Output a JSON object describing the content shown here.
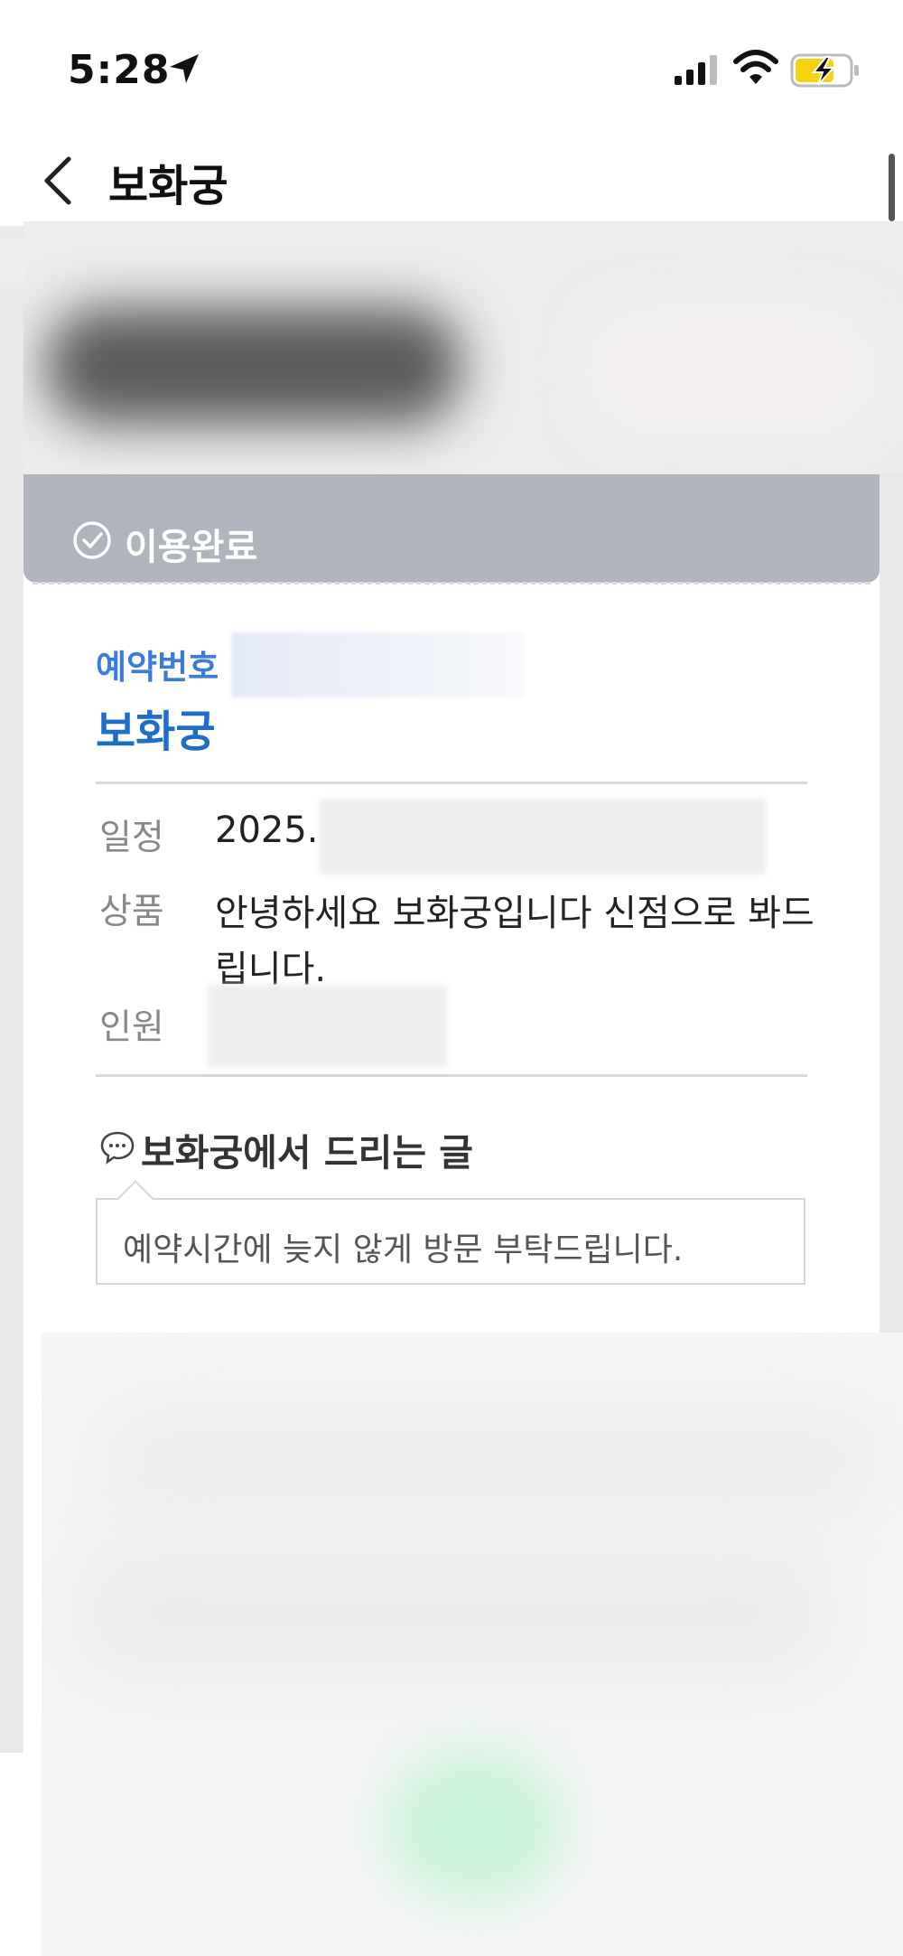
{
  "status_bar": {
    "time": "5:28"
  },
  "header": {
    "title": "보화궁"
  },
  "reservation": {
    "status": "이용완료",
    "number_label": "예약번호",
    "place_name": "보화궁",
    "rows": {
      "schedule_label": "일정",
      "schedule_value": "2025.",
      "product_label": "상품",
      "product_value_line1": "안녕하세요 보화궁입니다 신점으로 봐드",
      "product_value_line2": "립니다.",
      "people_label": "인원"
    },
    "message": {
      "title": "보화궁에서 드리는 글",
      "text": "예약시간에 늦지 않게 방문 부탁드립니다."
    }
  },
  "colors": {
    "accent_blue": "#1e6ec8",
    "label_blue": "#3b7bd9",
    "status_gray": "#b0b5bd",
    "battery_yellow": "#f5d40f"
  },
  "icons": [
    "location-arrow-icon",
    "signal-icon",
    "wifi-icon",
    "battery-charging-icon",
    "back-chevron-icon",
    "check-circle-icon",
    "chat-bubble-icon"
  ]
}
